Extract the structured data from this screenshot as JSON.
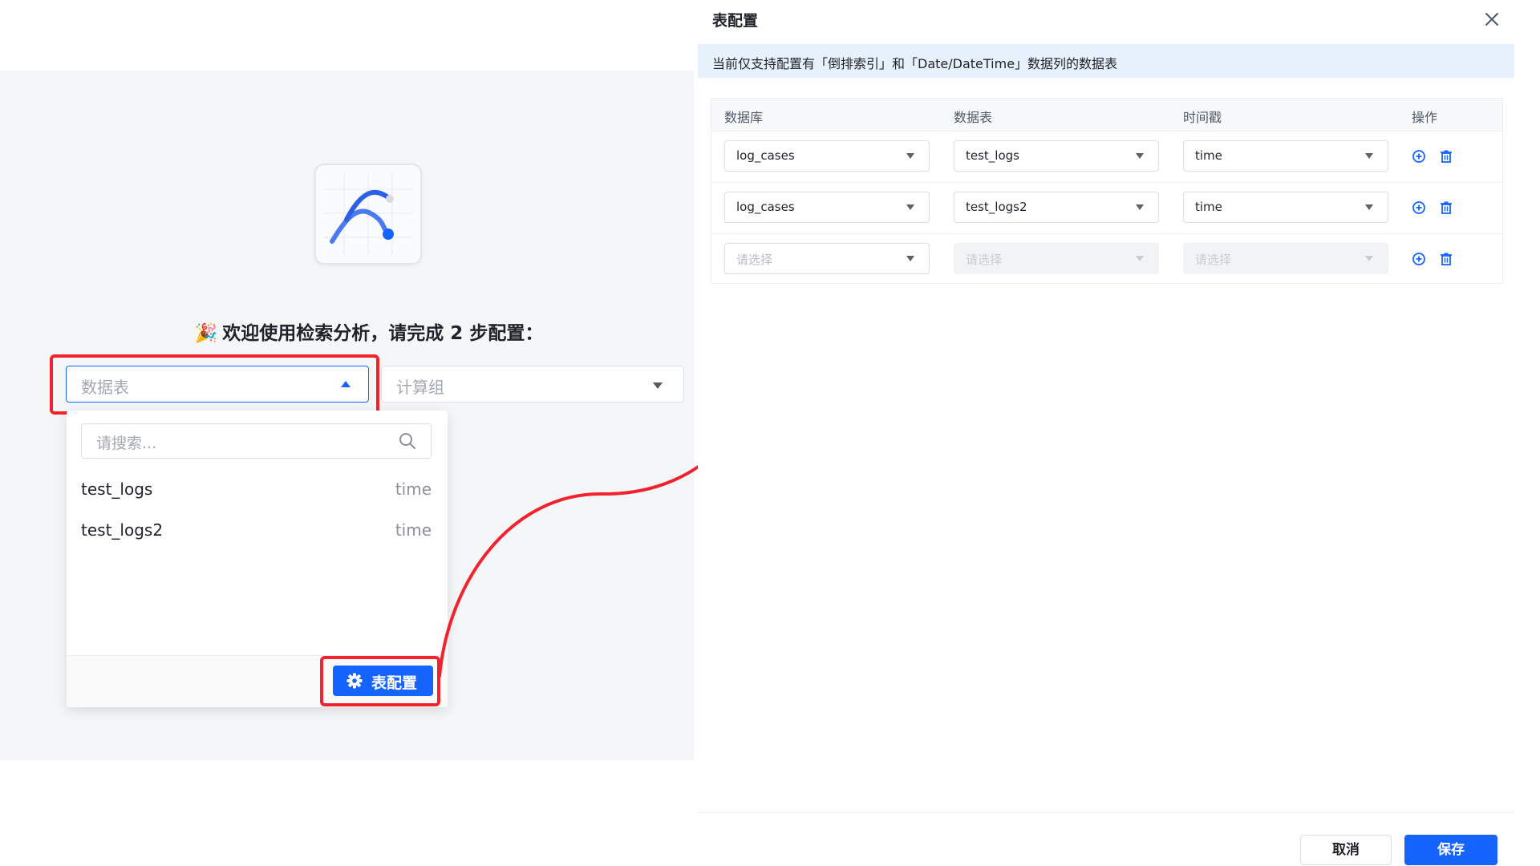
{
  "colors": {
    "accent": "#1664ff",
    "highlight": "#f5222d",
    "notice_bg": "#e6f1fc"
  },
  "welcome": {
    "emoji": "🎉",
    "text": "欢迎使用检索分析，请完成 2 步配置："
  },
  "table_select": {
    "placeholder": "数据表",
    "state": "open"
  },
  "group_select": {
    "placeholder": "计算组"
  },
  "dropdown": {
    "search_placeholder": "请搜索...",
    "options": [
      {
        "name": "test_logs",
        "type": "time"
      },
      {
        "name": "test_logs2",
        "type": "time"
      }
    ],
    "config_button": "表配置"
  },
  "dialog": {
    "title": "表配置",
    "notice": "当前仅支持配置有「倒排索引」和「Date/DateTime」数据列的数据表",
    "columns": [
      "数据库",
      "数据表",
      "时间戳",
      "操作"
    ],
    "rows": [
      {
        "database": "log_cases",
        "table": "test_logs",
        "timestamp": "time",
        "disabled": false
      },
      {
        "database": "log_cases",
        "table": "test_logs2",
        "timestamp": "time",
        "disabled": false
      },
      {
        "database": "请选择",
        "table": "请选择",
        "timestamp": "请选择",
        "disabled": true
      }
    ],
    "cancel": "取消",
    "save": "保存"
  }
}
